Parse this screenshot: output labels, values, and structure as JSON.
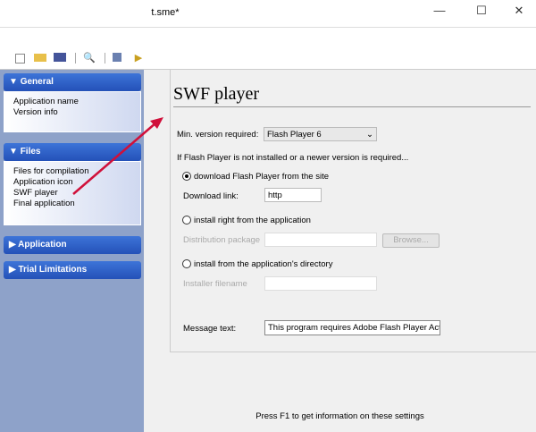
{
  "window": {
    "title": "t.sme*",
    "minimize": "—",
    "maximize": "☐",
    "close": "✕"
  },
  "toolbar": {
    "icons": [
      "new-icon",
      "open-icon",
      "save-icon",
      "preview-icon",
      "print-icon",
      "run-icon"
    ]
  },
  "sidebar": {
    "sections": [
      {
        "label": "General",
        "expanded": true,
        "items": [
          "Application name",
          "Version info"
        ]
      },
      {
        "label": "Files",
        "expanded": true,
        "items": [
          "Files for compilation",
          "Application icon",
          "SWF player",
          "Final application"
        ]
      },
      {
        "label": "Application",
        "expanded": false,
        "items": []
      },
      {
        "label": "Trial Limitations",
        "expanded": false,
        "items": []
      }
    ]
  },
  "main": {
    "heading": "SWF player",
    "min_version_label": "Min. version required:",
    "min_version_value": "Flash Player 6",
    "if_not_installed": "If Flash Player is not installed or a newer version is required...",
    "opt_download": "download Flash Player from the site",
    "download_link_label": "Download link:",
    "download_link_value": "http",
    "opt_install_app": "install right from the application",
    "dist_package_label": "Distribution package",
    "browse_label": "Browse...",
    "opt_install_dir": "install from the application's directory",
    "installer_label": "Installer filename",
    "message_label": "Message text:",
    "message_value": "This program requires Adobe Flash Player ActiveX",
    "selected_option": "download"
  },
  "footer": "Press F1 to get information on these settings",
  "colors": {
    "sidebar": "#8ea2c9",
    "section_header": "#2f5fc8",
    "annotation_arrow": "#d0103a"
  }
}
